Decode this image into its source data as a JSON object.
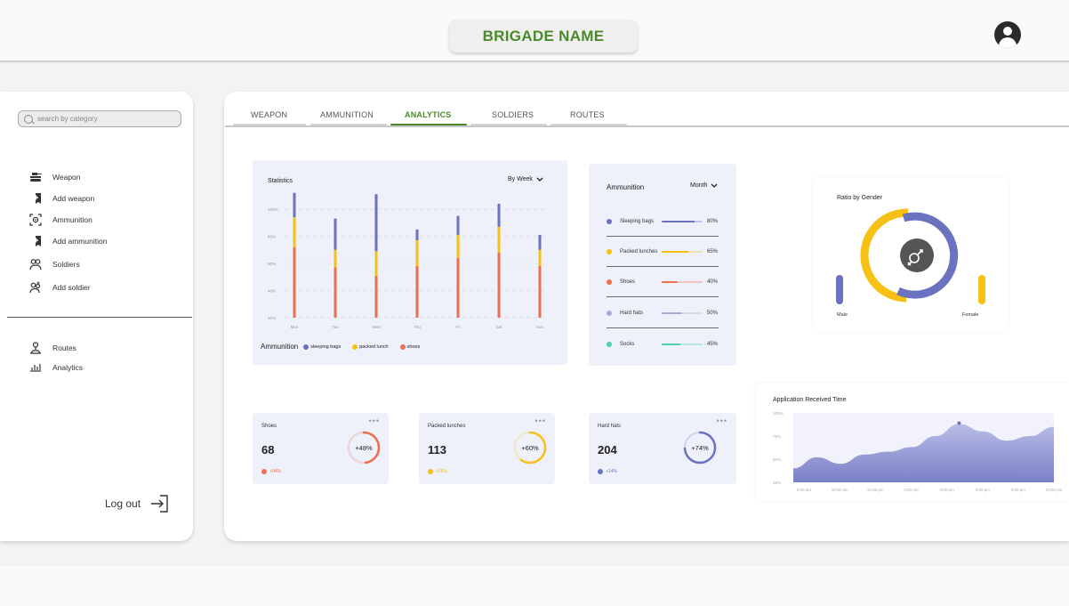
{
  "header": {
    "brand": "BRIGADE NAME"
  },
  "sidebar": {
    "search_placeholder": "search by category",
    "items": [
      {
        "label": "Weapon",
        "icon": "tank-icon"
      },
      {
        "label": "Add weapon",
        "icon": "add-bookmark-icon"
      },
      {
        "label": "Ammunition",
        "icon": "target-icon"
      },
      {
        "label": "Add ammunition",
        "icon": "add-bookmark-icon"
      },
      {
        "label": "Soldiers",
        "icon": "people-icon"
      },
      {
        "label": "Add soldier",
        "icon": "add-person-icon"
      }
    ],
    "items2": [
      {
        "label": "Routes",
        "icon": "route-icon"
      },
      {
        "label": "Analytics",
        "icon": "analytics-icon"
      }
    ],
    "logout_label": "Log out"
  },
  "tabs": [
    "WEAPON",
    "AMMUNITION",
    "ANALYTICS",
    "SOLDIERS",
    "ROUTES"
  ],
  "active_tab": "ANALYTICS",
  "colors": {
    "accent": "#4a8a2a",
    "blue": "#6b72c0",
    "yellow": "#f6c114",
    "orange": "#ef6e50",
    "lavender": "#a9a9db",
    "green": "#4fd0a4"
  },
  "statistics": {
    "title": "Statistics",
    "period": "By Week",
    "legend_title": "Ammunition",
    "chart_data": {
      "type": "bar",
      "stacked": true,
      "categories": [
        "Mon",
        "Tue",
        "Wed",
        "Thu",
        "Fri",
        "Sat",
        "Sun"
      ],
      "yticks": [
        "100%",
        "80%",
        "60%",
        "40%",
        "20%"
      ],
      "ylim": [
        20,
        100
      ],
      "series": [
        {
          "name": "shoes",
          "color": "#ef6e50",
          "values": [
            52,
            37,
            31,
            38,
            44,
            48,
            38
          ]
        },
        {
          "name": "packed lunch",
          "color": "#f6c114",
          "values": [
            22,
            13,
            18,
            19,
            17,
            19,
            12
          ]
        },
        {
          "name": "sleeping bags",
          "color": "#6b72c0",
          "values": [
            18,
            23,
            42,
            8,
            14,
            17,
            11
          ]
        }
      ]
    }
  },
  "ammunition": {
    "title": "Ammunition",
    "period": "Month",
    "items": [
      {
        "label": "Sleeping bags",
        "pct": "80%",
        "value": 80,
        "color": "#6b72c0"
      },
      {
        "label": "Packed lunches",
        "pct": "65%",
        "value": 65,
        "color": "#f6c114"
      },
      {
        "label": "Shoes",
        "pct": "40%",
        "value": 40,
        "color": "#ef6e50"
      },
      {
        "label": "Hard hats",
        "pct": "50%",
        "value": 50,
        "color": "#a9a9db"
      },
      {
        "label": "Socks",
        "pct": "45%",
        "value": 45,
        "color": "#4fd0a4"
      }
    ]
  },
  "gender": {
    "title": "Ratio by Gender",
    "male_label": "Male",
    "female_label": "Female",
    "icon": "gender-icon"
  },
  "kpis": [
    {
      "title": "Shoes",
      "value": "68",
      "ring": "+48%",
      "ring_value": 48,
      "delta": "+04%",
      "color": "#ef6e50"
    },
    {
      "title": "Packed lunches",
      "value": "113",
      "ring": "+60%",
      "ring_value": 60,
      "delta": "+06%",
      "color": "#f6c114"
    },
    {
      "title": "Hard hats",
      "value": "204",
      "ring": "+74%",
      "ring_value": 74,
      "delta": "+14%",
      "color": "#6b72c0"
    }
  ],
  "app_time": {
    "title": "Application Received Time",
    "chart_data": {
      "type": "area",
      "yticks": [
        "100%",
        "75%",
        "50%",
        "25%"
      ],
      "ylim": [
        25,
        100
      ],
      "x": [
        "8:00 am",
        "10:00 am",
        "12:00 pm",
        "2:00 pm",
        "4:00 pm",
        "6:00 pm",
        "8:00 pm",
        "10:00 pm"
      ],
      "values": [
        40,
        52,
        45,
        55,
        58,
        63,
        75,
        88,
        80,
        70,
        75,
        85
      ]
    }
  }
}
